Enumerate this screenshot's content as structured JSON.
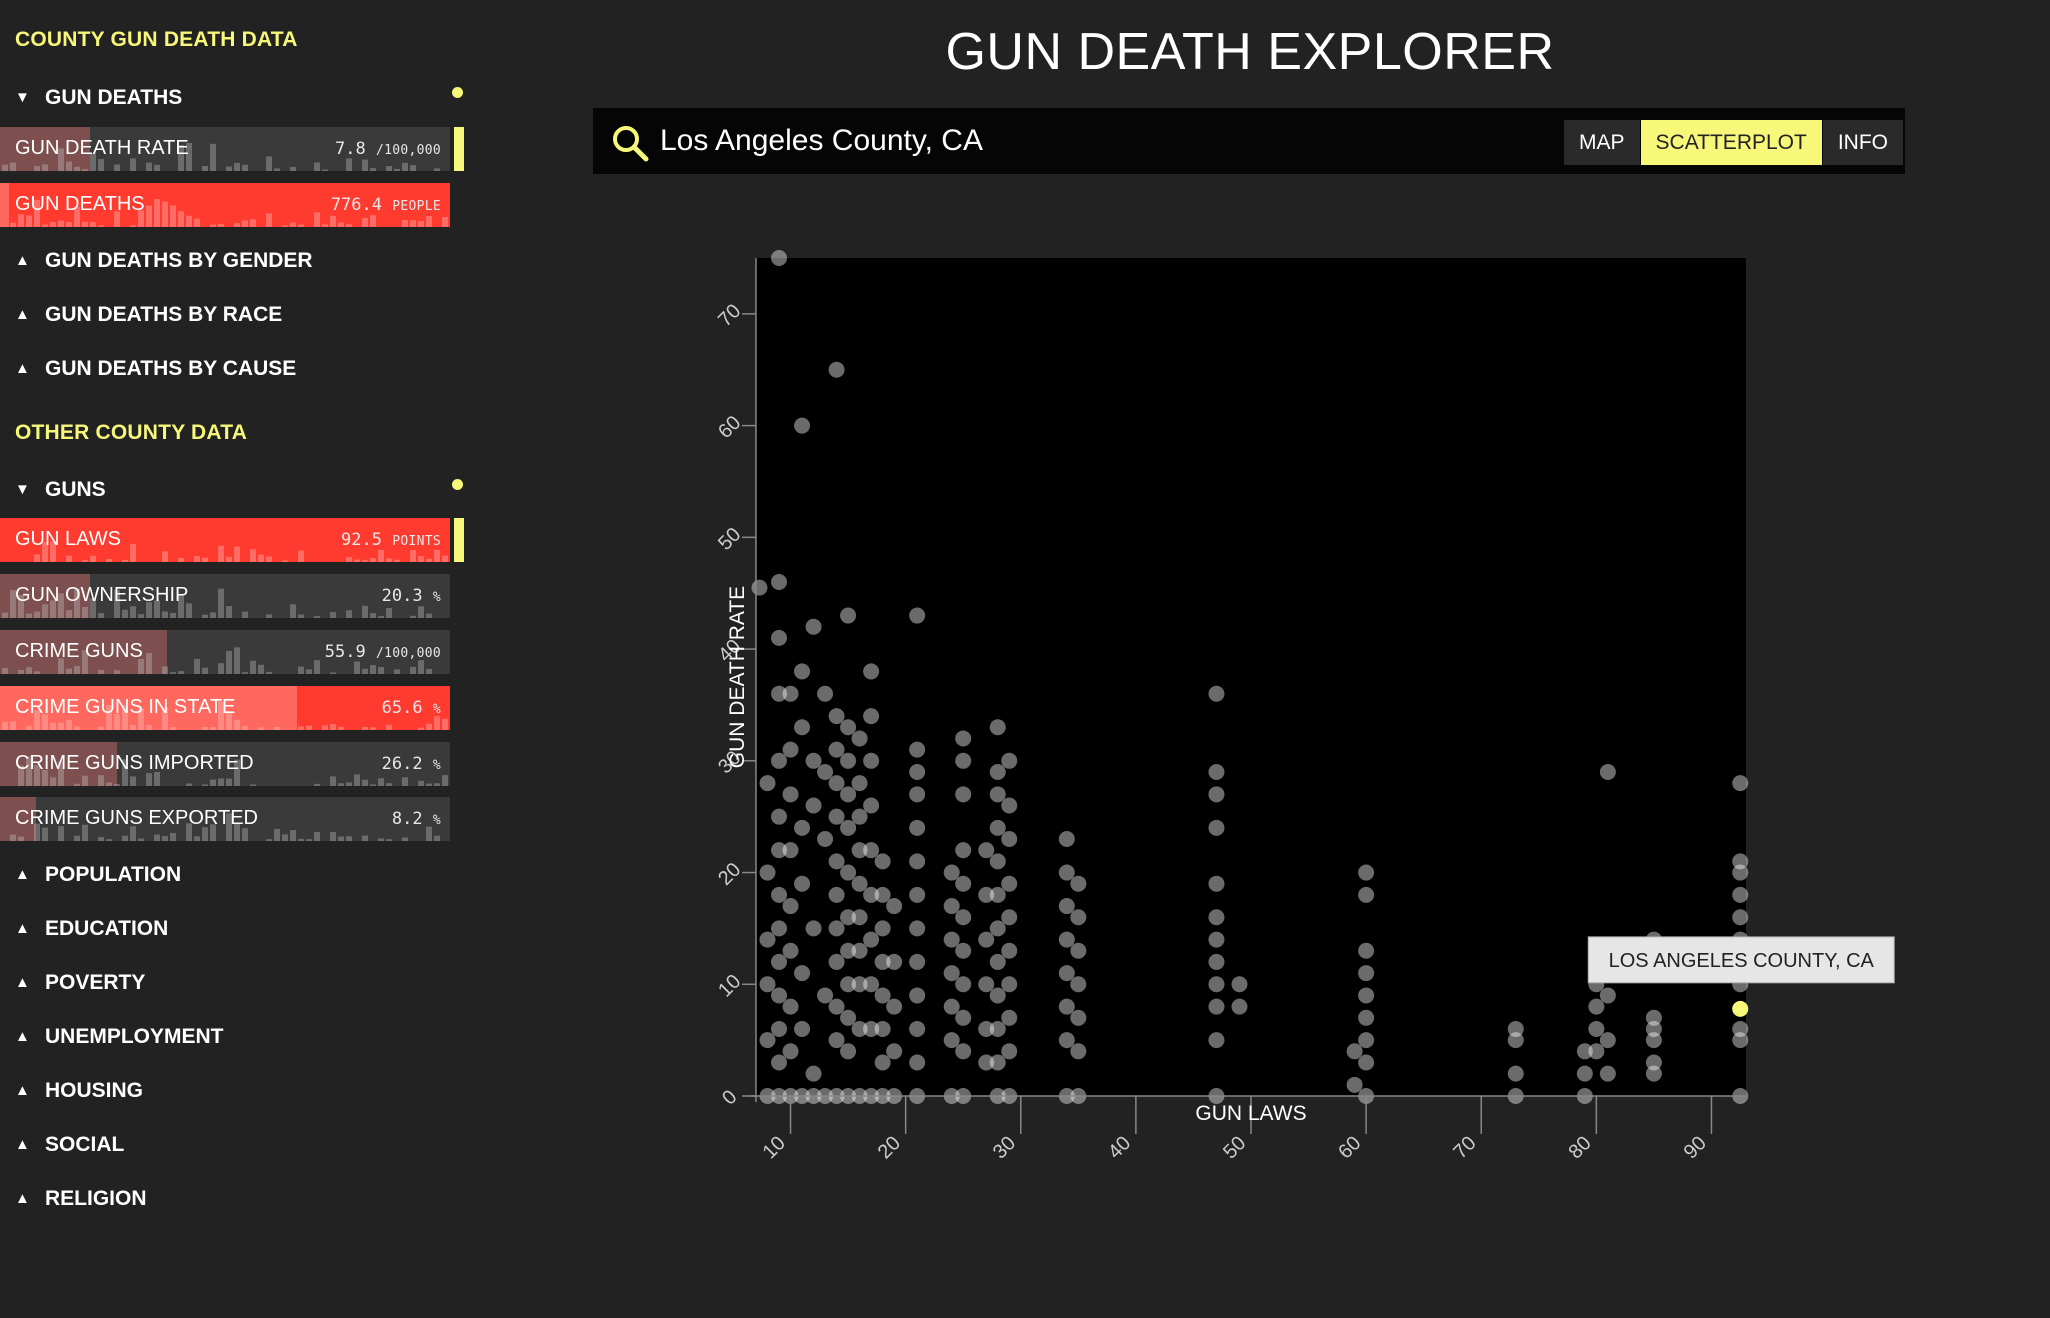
{
  "sidebar": {
    "title1": "COUNTY GUN DEATH DATA",
    "title2": "OTHER COUNTY DATA",
    "group_gun_deaths": "GUN DEATHS",
    "group_gender": "GUN DEATHS BY GENDER",
    "group_race": "GUN DEATHS BY RACE",
    "group_cause": "GUN DEATHS BY CAUSE",
    "group_guns": "GUNS",
    "group_population": "POPULATION",
    "group_education": "EDUCATION",
    "group_poverty": "POVERTY",
    "group_unemployment": "UNEMPLOYMENT",
    "group_housing": "HOUSING",
    "group_social": "SOCIAL",
    "group_religion": "RELIGION",
    "caret_open": "▼",
    "caret_closed": "▲",
    "metrics": [
      {
        "label": "GUN DEATH RATE",
        "value": "7.8",
        "unit": "/100,000",
        "fill": 0.2,
        "red": false
      },
      {
        "label": "GUN DEATHS",
        "value": "776.4",
        "unit": "PEOPLE",
        "fill": 0.02,
        "red": true
      },
      {
        "label": "GUN LAWS",
        "value": "92.5",
        "unit": "POINTS",
        "fill": 0.0,
        "red": true
      },
      {
        "label": "GUN OWNERSHIP",
        "value": "20.3",
        "unit": "%",
        "fill": 0.2,
        "red": false
      },
      {
        "label": "CRIME GUNS",
        "value": "55.9",
        "unit": "/100,000",
        "fill": 0.37,
        "red": false
      },
      {
        "label": "CRIME GUNS IN STATE",
        "value": "65.6",
        "unit": "%",
        "fill": 0.66,
        "red": true
      },
      {
        "label": "CRIME GUNS IMPORTED",
        "value": "26.2",
        "unit": "%",
        "fill": 0.26,
        "red": false
      },
      {
        "label": "CRIME GUNS EXPORTED",
        "value": "8.2",
        "unit": "%",
        "fill": 0.08,
        "red": false
      }
    ]
  },
  "header": {
    "title": "GUN DEATH EXPLORER"
  },
  "search": {
    "value": "Los Angeles County, CA"
  },
  "tabs": [
    "MAP",
    "SCATTERPLOT",
    "INFO"
  ],
  "active_tab": "SCATTERPLOT",
  "colors": {
    "accent": "#f7f77a",
    "red": "#ff3b30",
    "point": "#ffffff",
    "highlight": "#f7f77a"
  },
  "chart_data": {
    "type": "scatter",
    "xlabel": "GUN LAWS",
    "ylabel": "GUN DEATH RATE",
    "xlim": [
      7,
      93
    ],
    "ylim": [
      0,
      75
    ],
    "xticks": [
      10,
      20,
      30,
      40,
      50,
      60,
      70,
      80,
      90
    ],
    "yticks": [
      0,
      10,
      20,
      30,
      40,
      50,
      60,
      70
    ],
    "tooltip": "LOS ANGELES COUNTY, CA",
    "highlight": {
      "x": 92.5,
      "y": 7.8
    },
    "points": [
      [
        7.3,
        45.5
      ],
      [
        9,
        75
      ],
      [
        9,
        46
      ],
      [
        9,
        41
      ],
      [
        9,
        36
      ],
      [
        9,
        30
      ],
      [
        9,
        25
      ],
      [
        9,
        22
      ],
      [
        9,
        18
      ],
      [
        9,
        15
      ],
      [
        9,
        12
      ],
      [
        9,
        9
      ],
      [
        9,
        6
      ],
      [
        9,
        3
      ],
      [
        9,
        0
      ],
      [
        8,
        28
      ],
      [
        8,
        20
      ],
      [
        8,
        14
      ],
      [
        8,
        10
      ],
      [
        8,
        5
      ],
      [
        8,
        0
      ],
      [
        10,
        36
      ],
      [
        10,
        31
      ],
      [
        10,
        27
      ],
      [
        10,
        22
      ],
      [
        10,
        17
      ],
      [
        10,
        13
      ],
      [
        10,
        8
      ],
      [
        10,
        4
      ],
      [
        10,
        0
      ],
      [
        11,
        60
      ],
      [
        11,
        38
      ],
      [
        11,
        33
      ],
      [
        11,
        24
      ],
      [
        11,
        19
      ],
      [
        11,
        11
      ],
      [
        11,
        6
      ],
      [
        11,
        0
      ],
      [
        12,
        42
      ],
      [
        12,
        30
      ],
      [
        12,
        26
      ],
      [
        12,
        15
      ],
      [
        12,
        2
      ],
      [
        12,
        0
      ],
      [
        13,
        36
      ],
      [
        13,
        29
      ],
      [
        13,
        23
      ],
      [
        13,
        9
      ],
      [
        13,
        0
      ],
      [
        14,
        65
      ],
      [
        14,
        34
      ],
      [
        14,
        31
      ],
      [
        14,
        28
      ],
      [
        14,
        25
      ],
      [
        14,
        21
      ],
      [
        14,
        18
      ],
      [
        14,
        15
      ],
      [
        14,
        12
      ],
      [
        14,
        8
      ],
      [
        14,
        5
      ],
      [
        14,
        0
      ],
      [
        15,
        43
      ],
      [
        15,
        33
      ],
      [
        15,
        30
      ],
      [
        15,
        27
      ],
      [
        15,
        24
      ],
      [
        15,
        20
      ],
      [
        15,
        16
      ],
      [
        15,
        13
      ],
      [
        15,
        10
      ],
      [
        15,
        7
      ],
      [
        15,
        4
      ],
      [
        15,
        0
      ],
      [
        16,
        32
      ],
      [
        16,
        28
      ],
      [
        16,
        25
      ],
      [
        16,
        22
      ],
      [
        16,
        19
      ],
      [
        16,
        16
      ],
      [
        16,
        13
      ],
      [
        16,
        10
      ],
      [
        16,
        6
      ],
      [
        16,
        0
      ],
      [
        17,
        38
      ],
      [
        17,
        34
      ],
      [
        17,
        30
      ],
      [
        17,
        26
      ],
      [
        17,
        22
      ],
      [
        17,
        18
      ],
      [
        17,
        14
      ],
      [
        17,
        10
      ],
      [
        17,
        6
      ],
      [
        17,
        0
      ],
      [
        18,
        21
      ],
      [
        18,
        18
      ],
      [
        18,
        15
      ],
      [
        18,
        12
      ],
      [
        18,
        9
      ],
      [
        18,
        6
      ],
      [
        18,
        3
      ],
      [
        18,
        0
      ],
      [
        19,
        17
      ],
      [
        19,
        12
      ],
      [
        19,
        8
      ],
      [
        19,
        4
      ],
      [
        19,
        0
      ],
      [
        21,
        43
      ],
      [
        21,
        31
      ],
      [
        21,
        29
      ],
      [
        21,
        27
      ],
      [
        21,
        24
      ],
      [
        21,
        21
      ],
      [
        21,
        18
      ],
      [
        21,
        15
      ],
      [
        21,
        12
      ],
      [
        21,
        9
      ],
      [
        21,
        6
      ],
      [
        21,
        3
      ],
      [
        21,
        0
      ],
      [
        24,
        20
      ],
      [
        24,
        17
      ],
      [
        24,
        14
      ],
      [
        24,
        11
      ],
      [
        24,
        8
      ],
      [
        24,
        5
      ],
      [
        24,
        0
      ],
      [
        25,
        32
      ],
      [
        25,
        30
      ],
      [
        25,
        27
      ],
      [
        25,
        22
      ],
      [
        25,
        19
      ],
      [
        25,
        16
      ],
      [
        25,
        13
      ],
      [
        25,
        10
      ],
      [
        25,
        7
      ],
      [
        25,
        4
      ],
      [
        25,
        0
      ],
      [
        27,
        22
      ],
      [
        27,
        18
      ],
      [
        27,
        14
      ],
      [
        27,
        10
      ],
      [
        27,
        6
      ],
      [
        27,
        3
      ],
      [
        28,
        33
      ],
      [
        28,
        29
      ],
      [
        28,
        27
      ],
      [
        28,
        24
      ],
      [
        28,
        21
      ],
      [
        28,
        18
      ],
      [
        28,
        15
      ],
      [
        28,
        12
      ],
      [
        28,
        9
      ],
      [
        28,
        6
      ],
      [
        28,
        3
      ],
      [
        28,
        0
      ],
      [
        29,
        30
      ],
      [
        29,
        26
      ],
      [
        29,
        23
      ],
      [
        29,
        19
      ],
      [
        29,
        16
      ],
      [
        29,
        13
      ],
      [
        29,
        10
      ],
      [
        29,
        7
      ],
      [
        29,
        4
      ],
      [
        29,
        0
      ],
      [
        34,
        23
      ],
      [
        34,
        20
      ],
      [
        34,
        17
      ],
      [
        34,
        14
      ],
      [
        34,
        11
      ],
      [
        34,
        8
      ],
      [
        34,
        5
      ],
      [
        34,
        0
      ],
      [
        35,
        19
      ],
      [
        35,
        16
      ],
      [
        35,
        13
      ],
      [
        35,
        10
      ],
      [
        35,
        7
      ],
      [
        35,
        4
      ],
      [
        35,
        0
      ],
      [
        47,
        36
      ],
      [
        47,
        29
      ],
      [
        47,
        27
      ],
      [
        47,
        24
      ],
      [
        47,
        19
      ],
      [
        47,
        16
      ],
      [
        47,
        14
      ],
      [
        47,
        12
      ],
      [
        47,
        10
      ],
      [
        47,
        8
      ],
      [
        47,
        5
      ],
      [
        47,
        0
      ],
      [
        49,
        10
      ],
      [
        49,
        8
      ],
      [
        59,
        4
      ],
      [
        59,
        1
      ],
      [
        60,
        20
      ],
      [
        60,
        18
      ],
      [
        60,
        13
      ],
      [
        60,
        11
      ],
      [
        60,
        9
      ],
      [
        60,
        7
      ],
      [
        60,
        5
      ],
      [
        60,
        3
      ],
      [
        60,
        0
      ],
      [
        73,
        6
      ],
      [
        73,
        5
      ],
      [
        73,
        2
      ],
      [
        73,
        0
      ],
      [
        79,
        4
      ],
      [
        79,
        2
      ],
      [
        79,
        0
      ],
      [
        80,
        10
      ],
      [
        80,
        8
      ],
      [
        80,
        6
      ],
      [
        80,
        4
      ],
      [
        81,
        29
      ],
      [
        81,
        12
      ],
      [
        81,
        9
      ],
      [
        81,
        5
      ],
      [
        81,
        2
      ],
      [
        85,
        14
      ],
      [
        85,
        7
      ],
      [
        85,
        6
      ],
      [
        85,
        5
      ],
      [
        85,
        3
      ],
      [
        85,
        2
      ],
      [
        92.5,
        28
      ],
      [
        92.5,
        21
      ],
      [
        92.5,
        20
      ],
      [
        92.5,
        18
      ],
      [
        92.5,
        16
      ],
      [
        92.5,
        14
      ],
      [
        92.5,
        12
      ],
      [
        92.5,
        10
      ],
      [
        92.5,
        6
      ],
      [
        92.5,
        5
      ],
      [
        92.5,
        0
      ]
    ]
  }
}
